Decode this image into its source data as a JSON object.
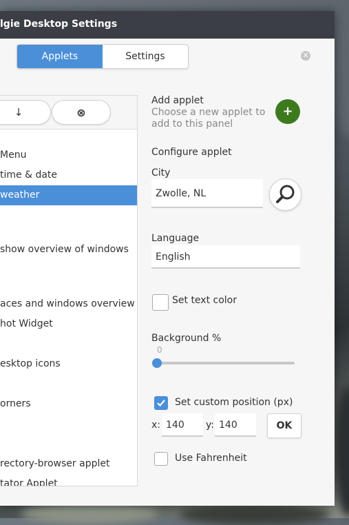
{
  "window": {
    "title": "lgie Desktop Settings"
  },
  "tabs": [
    {
      "label": "Applets",
      "active": true
    },
    {
      "label": "Settings",
      "active": false
    }
  ],
  "toolbar": {
    "down_glyph": "↓",
    "remove_glyph": "⊗"
  },
  "applets": {
    "items": [
      {
        "label": "Menu"
      },
      {
        "label": " time & date"
      },
      {
        "label": " weather",
        "selected": true
      },
      {
        "label": " show overview of windows"
      },
      {
        "label": "aces and windows overview"
      },
      {
        "label": "hot Widget"
      },
      {
        "label": "esktop icons"
      },
      {
        "label": "orners"
      },
      {
        "label": "rectory-browser applet"
      },
      {
        "label": "tator Applet"
      }
    ]
  },
  "add_applet": {
    "title": "Add applet",
    "description_line1": "Choose a new applet to",
    "description_line2": "add to this panel",
    "button_glyph": "+"
  },
  "configure": {
    "heading": "Configure applet",
    "city_label": "City",
    "city_value": "Zwolle, NL",
    "language_label": "Language",
    "language_value": "English",
    "set_text_color_label": "Set text color",
    "set_text_color_checked": false,
    "background_label": "Background %",
    "background_value": "0",
    "background_value_fraction": 0,
    "custom_position_label": "Set custom position (px)",
    "custom_position_checked": true,
    "x_label": "x:",
    "x_value": "140",
    "y_label": "y:",
    "y_value": "140",
    "ok_label": "OK",
    "fahrenheit_label": "Use Fahrenheit",
    "fahrenheit_checked": false
  },
  "icons": {
    "close": "close-icon",
    "search": "search-icon",
    "check": "checkmark-icon"
  },
  "colors": {
    "accent": "#4a8fd8",
    "add_button": "#3d7a1e",
    "titlebar": "#3b3e45"
  }
}
